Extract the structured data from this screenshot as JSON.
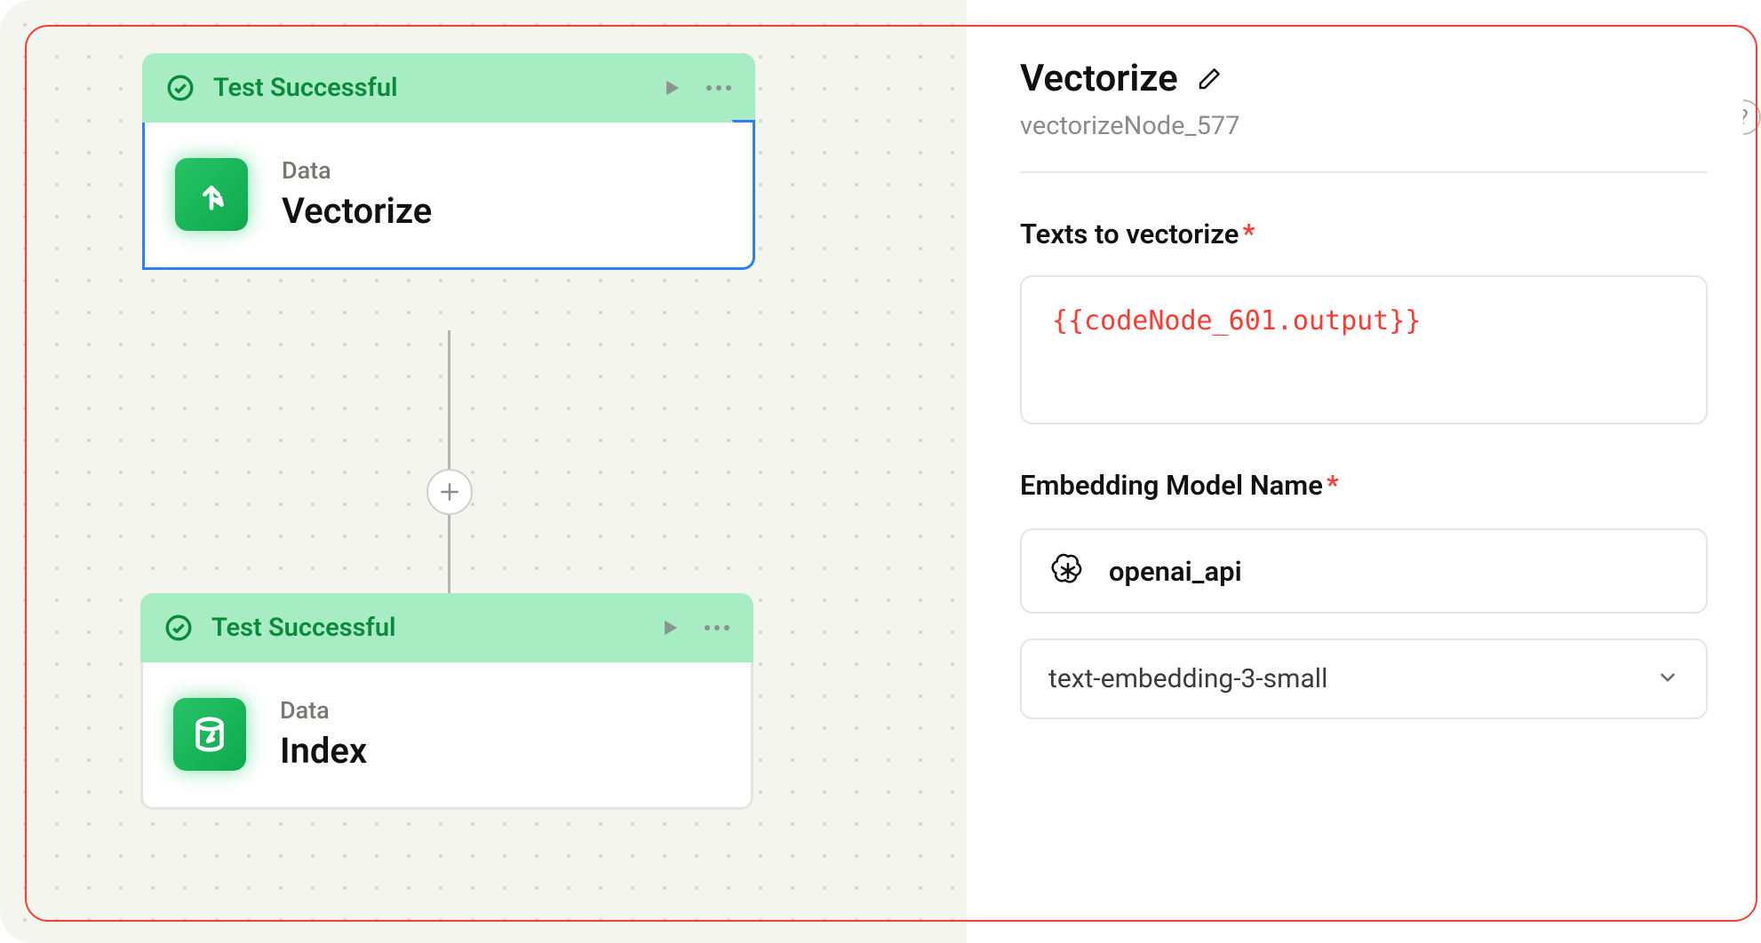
{
  "canvas": {
    "nodes": [
      {
        "status": "Test Successful",
        "category": "Data",
        "title": "Vectorize"
      },
      {
        "status": "Test Successful",
        "category": "Data",
        "title": "Index"
      }
    ]
  },
  "panel": {
    "title": "Vectorize",
    "subtitle": "vectorizeNode_577",
    "fields": {
      "texts_label": "Texts to vectorize",
      "texts_value": "{{codeNode_601.output}}",
      "model_label": "Embedding Model Name",
      "provider": "openai_api",
      "model_value": "text-embedding-3-small"
    }
  }
}
